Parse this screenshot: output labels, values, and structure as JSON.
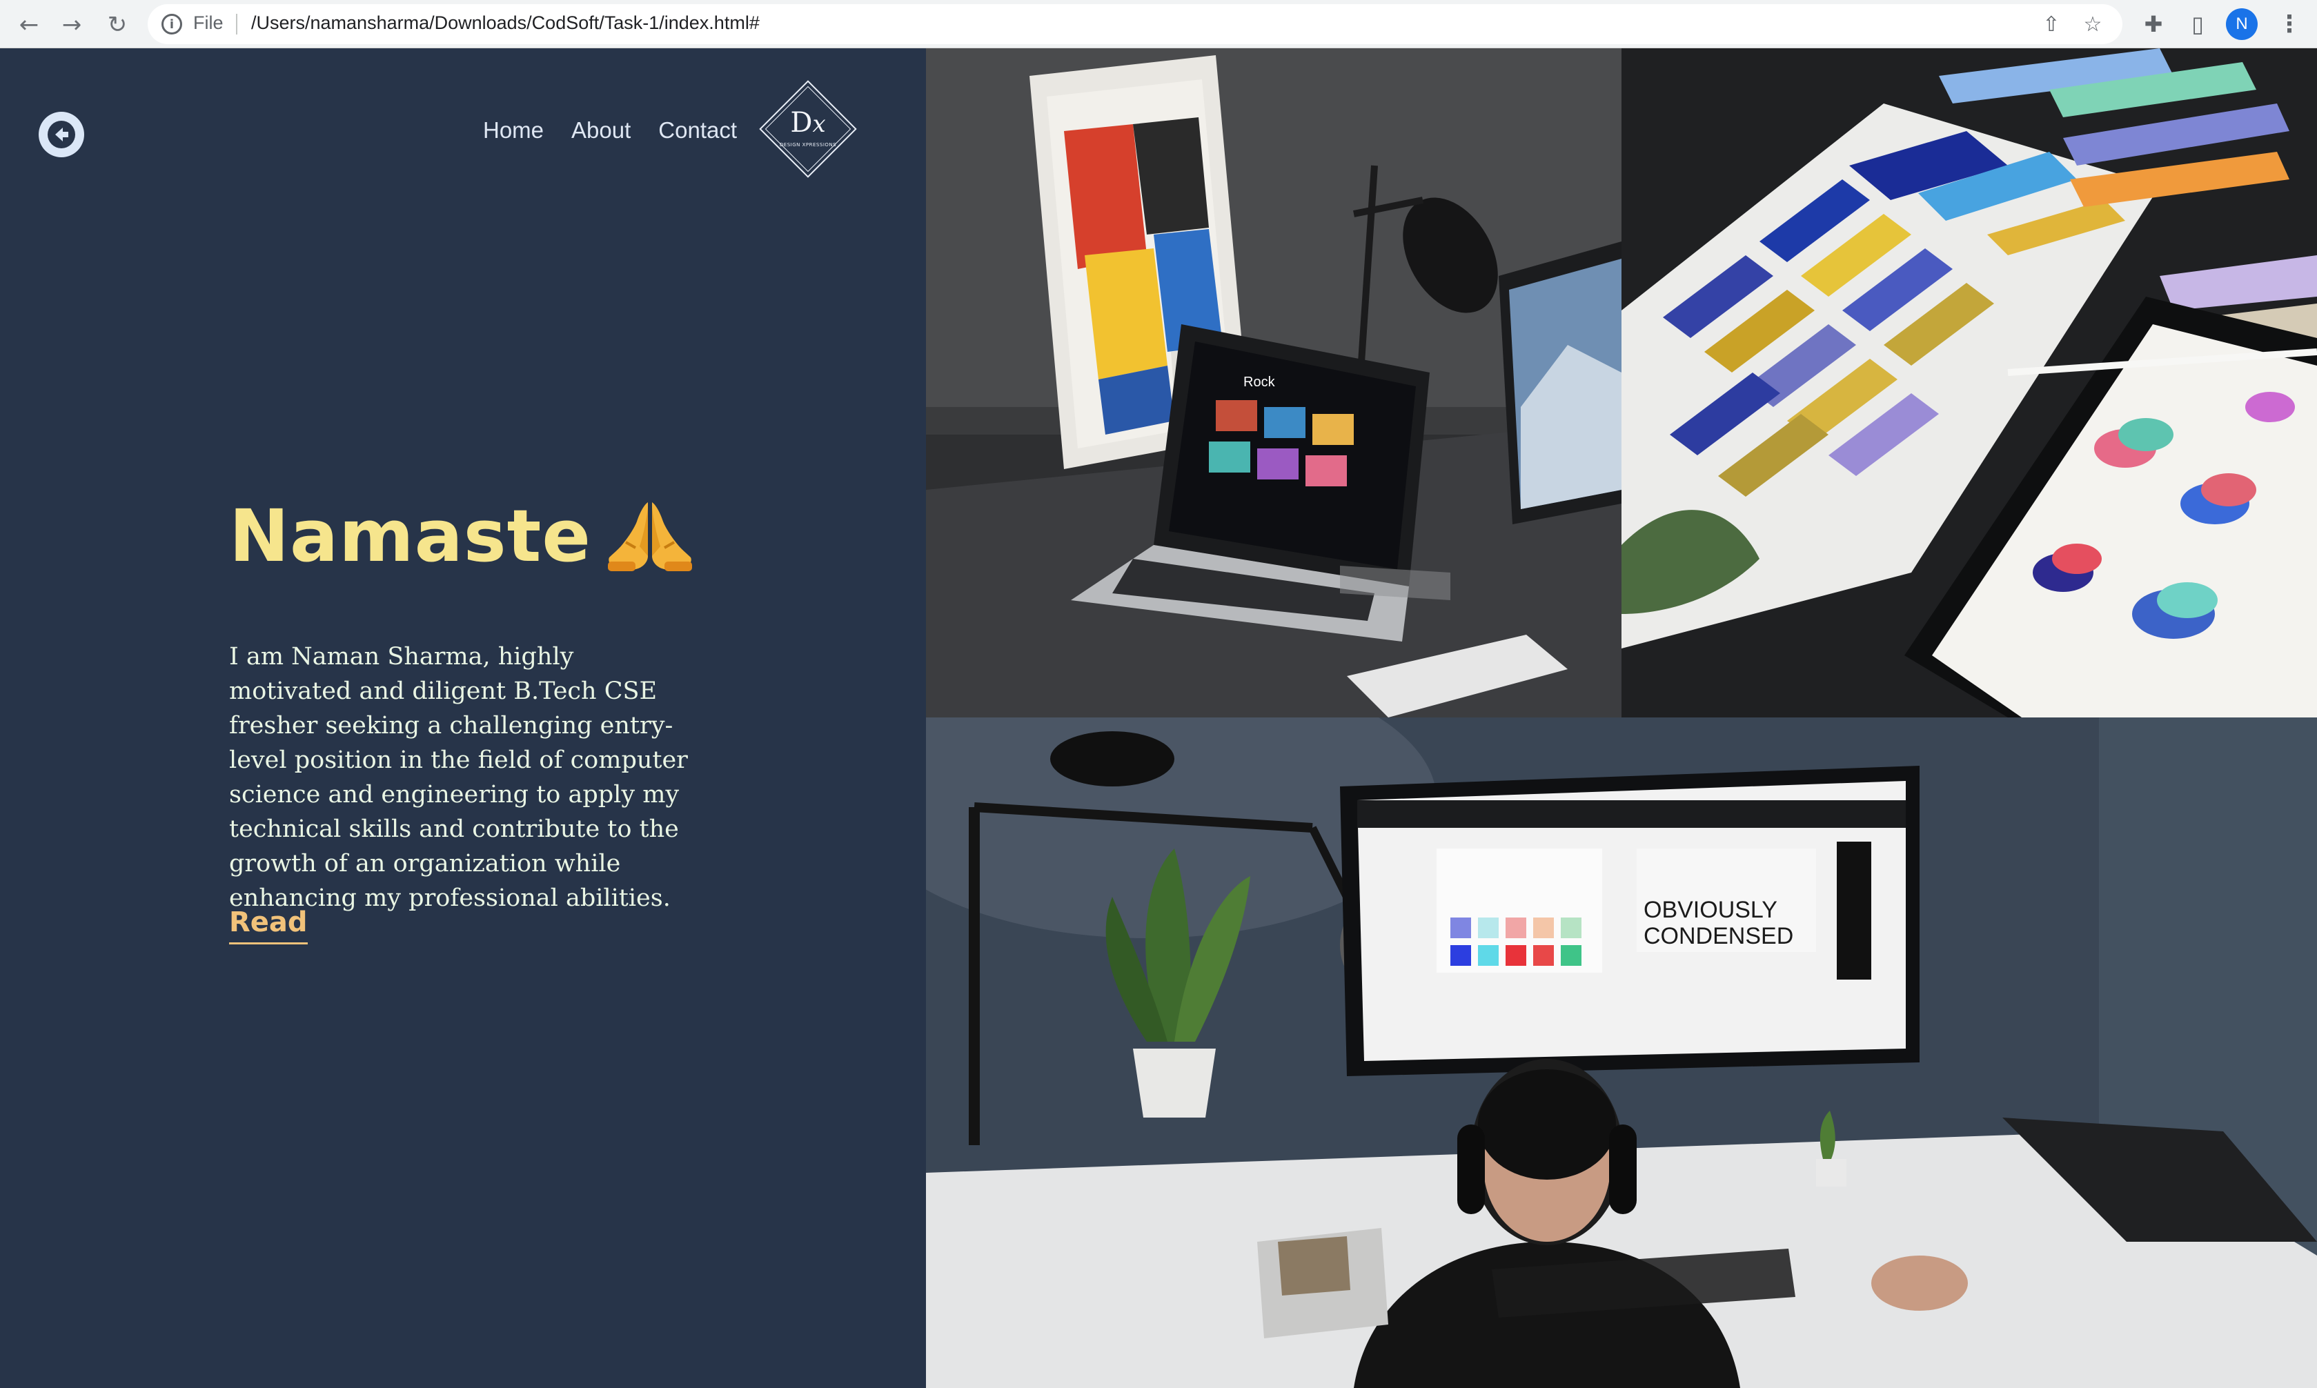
{
  "browser": {
    "file_label": "File",
    "url": "/Users/namansharma/Downloads/CodSoft/Task-1/index.html#",
    "profile_initial": "N"
  },
  "nav": {
    "items": [
      "Home",
      "About",
      "Contact"
    ]
  },
  "logo": {
    "letters": "D",
    "letters_script": "x",
    "subtitle": "DESIGN XPRESSIONS"
  },
  "hero": {
    "greeting": "Namaste",
    "greeting_emoji": "folded-hands",
    "bio": "I am Naman Sharma, highly motivated and diligent B.Tech CSE fresher seeking a challenging entry-level position in the field of computer science and engineering to apply my technical skills and contribute to the growth of an organization while enhancing my professional abilities.",
    "read_link": "Read"
  },
  "photos": {
    "desk": {
      "screen_title": "Rock"
    },
    "workspace": {
      "screen_text_line1": "OBVIOUSLY",
      "screen_text_line2": "CONDENSED"
    }
  },
  "colors": {
    "background": "#273449",
    "headline": "#f6e58d",
    "bio_text": "#e9f5e4",
    "read_link": "#f1c27a",
    "nav_text": "#dfe7f3"
  }
}
